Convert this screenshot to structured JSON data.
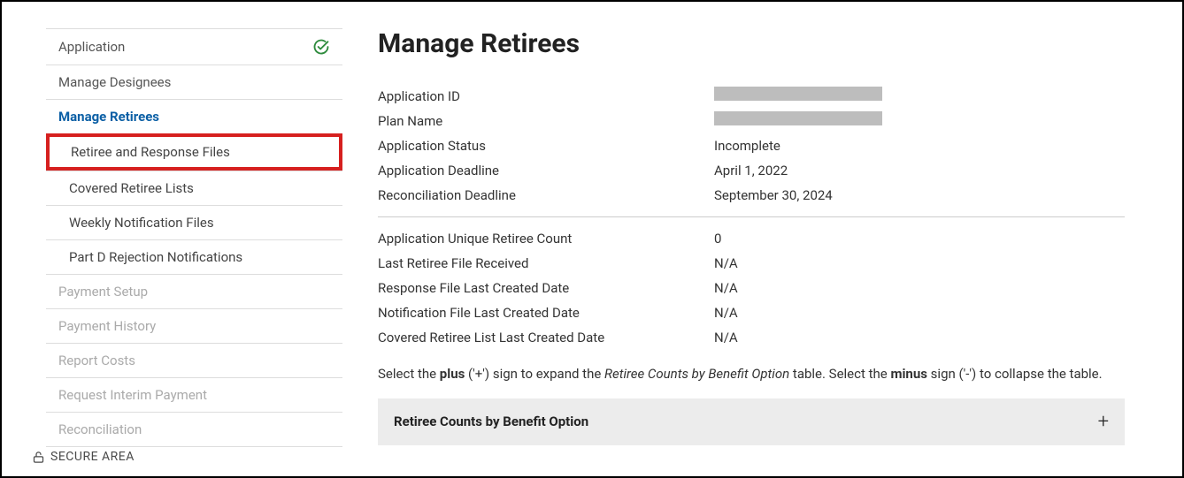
{
  "sidebar": {
    "items": [
      {
        "label": "Application",
        "checked": true
      },
      {
        "label": "Manage Designees"
      },
      {
        "label": "Manage Retirees",
        "active": true
      },
      {
        "label": "Retiree and Response Files",
        "sub": true,
        "highlighted": true
      },
      {
        "label": "Covered Retiree Lists",
        "sub": true
      },
      {
        "label": "Weekly Notification Files",
        "sub": true
      },
      {
        "label": "Part D Rejection Notifications",
        "sub": true
      },
      {
        "label": "Payment Setup",
        "disabled": true
      },
      {
        "label": "Payment History",
        "disabled": true
      },
      {
        "label": "Report Costs",
        "disabled": true
      },
      {
        "label": "Request Interim Payment",
        "disabled": true
      },
      {
        "label": "Reconciliation",
        "disabled": true
      }
    ]
  },
  "main": {
    "title": "Manage Retirees",
    "block1": [
      {
        "label": "Application ID",
        "value": "",
        "redacted": true
      },
      {
        "label": "Plan Name",
        "value": "",
        "redacted": true
      },
      {
        "label": "Application Status",
        "value": "Incomplete"
      },
      {
        "label": "Application Deadline",
        "value": "April 1, 2022"
      },
      {
        "label": "Reconciliation Deadline",
        "value": "September 30, 2024"
      }
    ],
    "block2": [
      {
        "label": "Application Unique Retiree Count",
        "value": "0"
      },
      {
        "label": "Last Retiree File Received",
        "value": "N/A"
      },
      {
        "label": "Response File Last Created Date",
        "value": "N/A"
      },
      {
        "label": "Notification File Last Created Date",
        "value": "N/A"
      },
      {
        "label": "Covered Retiree List Last Created Date",
        "value": "N/A"
      }
    ],
    "instructions": {
      "pre": "Select the ",
      "plus": "plus",
      "mid1": " ('+') sign to expand the ",
      "table_name": "Retiree Counts by Benefit Option",
      "mid2": " table. Select the ",
      "minus": "minus",
      "post": " sign ('-') to collapse the table."
    },
    "accordion": {
      "title": "Retiree Counts by Benefit Option"
    }
  },
  "footer": {
    "label": "SECURE AREA"
  }
}
